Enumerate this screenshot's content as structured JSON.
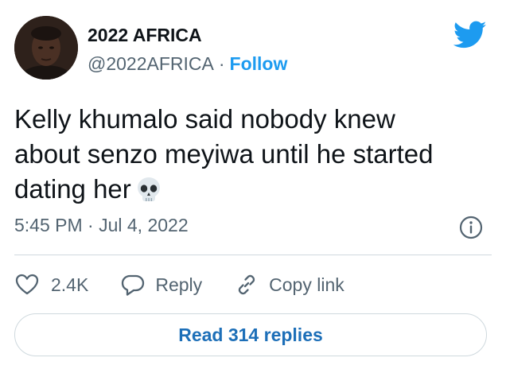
{
  "author": {
    "name": "2022 AFRICA",
    "handle": "@2022AFRICA",
    "separator": "·",
    "follow_label": "Follow"
  },
  "tweet": {
    "text_lines": [
      "Kelly khumalo said nobody knew",
      "about senzo meyiwa until he started",
      "dating her"
    ],
    "emoji": "skull-emoji"
  },
  "meta": {
    "timestamp": "5:45 PM · Jul 4, 2022"
  },
  "actions": {
    "like_count": "2.4K",
    "reply_label": "Reply",
    "copy_link_label": "Copy link"
  },
  "read_replies_label": "Read 314 replies",
  "colors": {
    "accent": "#1d9bf0",
    "text": "#0f1419",
    "muted": "#536471",
    "border": "#cfd9de"
  },
  "icons": [
    "avatar-photo",
    "twitter-bird-icon",
    "info-icon",
    "heart-icon",
    "reply-bubble-icon",
    "link-icon"
  ]
}
